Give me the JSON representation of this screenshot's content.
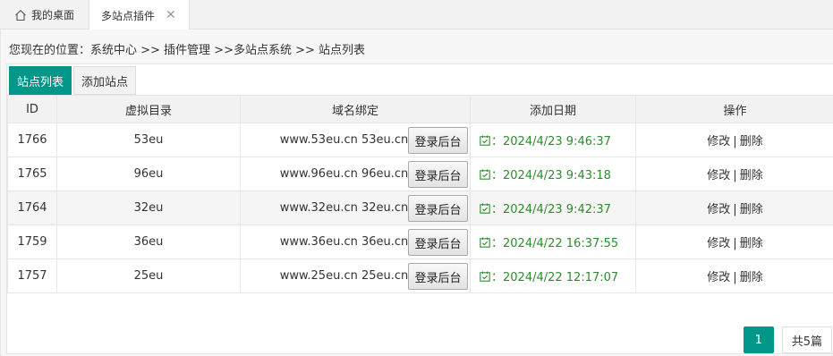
{
  "tabs": {
    "home_label": "我的桌面",
    "active_label": "多站点插件"
  },
  "breadcrumb": "您现在的位置：系统中心 >> 插件管理 >>多站点系统 >> 站点列表",
  "toolbar": {
    "list_label": "站点列表",
    "add_label": "添加站点"
  },
  "table": {
    "headers": [
      "ID",
      "虚拟目录",
      "域名绑定",
      "添加日期",
      "操作"
    ],
    "login_label": "登录后台",
    "edit_label": "修改",
    "delete_label": "删除",
    "separator": "|",
    "rows": [
      {
        "id": "1766",
        "dir": "53eu",
        "domain": "www.53eu.cn 53eu.cn",
        "date": "：2024/4/23 9:46:37"
      },
      {
        "id": "1765",
        "dir": "96eu",
        "domain": "www.96eu.cn 96eu.cn",
        "date": "：2024/4/23 9:43:18"
      },
      {
        "id": "1764",
        "dir": "32eu",
        "domain": "www.32eu.cn 32eu.cn",
        "date": "：2024/4/23 9:42:37"
      },
      {
        "id": "1759",
        "dir": "36eu",
        "domain": "www.36eu.cn 36eu.cn",
        "date": "：2024/4/22 16:37:55"
      },
      {
        "id": "1757",
        "dir": "25eu",
        "domain": "www.25eu.cn 25eu.cn",
        "date": "：2024/4/22 12:17:07"
      }
    ]
  },
  "pager": {
    "current": "1",
    "total": "共5篇"
  },
  "colors": {
    "accent": "#009688",
    "date_text": "#2e8b2e"
  },
  "icons": {
    "home": "home-icon",
    "close": "close-icon",
    "calendar": "calendar-icon"
  }
}
